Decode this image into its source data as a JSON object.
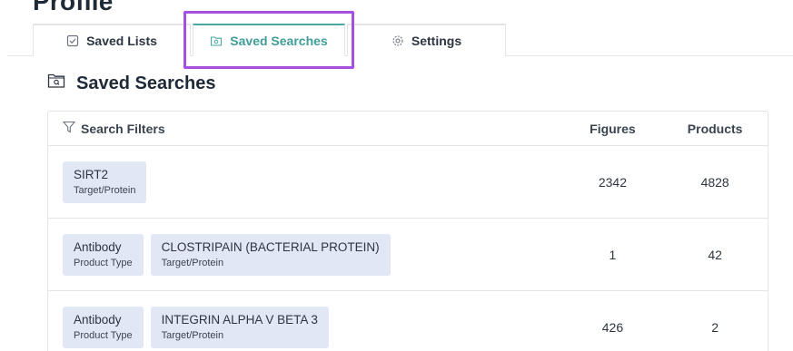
{
  "page": {
    "title": "Profile"
  },
  "tabs": [
    {
      "label": "Saved Lists",
      "icon": "list-check-icon"
    },
    {
      "label": "Saved Searches",
      "icon": "folder-search-icon",
      "active": true
    },
    {
      "label": "Settings",
      "icon": "gear-icon"
    }
  ],
  "section": {
    "title": "Saved Searches",
    "icon": "folder-search-icon"
  },
  "table": {
    "headers": {
      "filters": "Search Filters",
      "figures": "Figures",
      "products": "Products"
    },
    "rows": [
      {
        "chips": [
          {
            "value": "SIRT2",
            "label": "Target/Protein"
          }
        ],
        "figures": "2342",
        "products": "4828"
      },
      {
        "chips": [
          {
            "value": "Antibody",
            "label": "Product Type"
          },
          {
            "value": "CLOSTRIPAIN (BACTERIAL PROTEIN)",
            "label": "Target/Protein"
          }
        ],
        "figures": "1",
        "products": "42"
      },
      {
        "chips": [
          {
            "value": "Antibody",
            "label": "Product Type"
          },
          {
            "value": "INTEGRIN ALPHA V BETA 3",
            "label": "Target/Protein"
          }
        ],
        "figures": "426",
        "products": "2"
      }
    ]
  },
  "colors": {
    "accent": "#48a9a6",
    "highlight": "#a64fe0",
    "chip_bg": "#e2e7f5"
  }
}
